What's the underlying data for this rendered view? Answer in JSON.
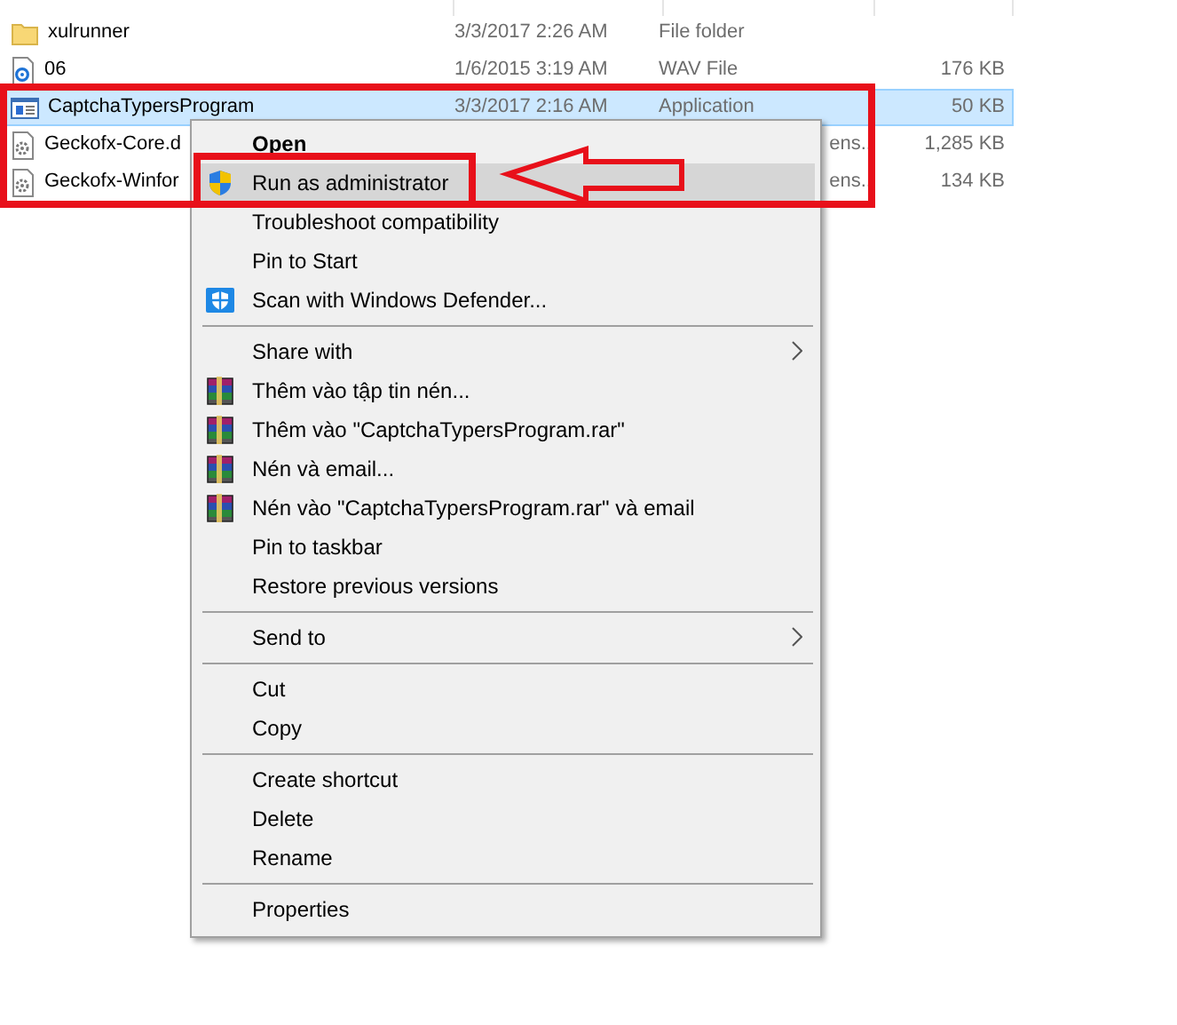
{
  "files": [
    {
      "name": "xulrunner",
      "date": "3/3/2017 2:26 AM",
      "type": "File folder",
      "kind": "folder",
      "selected": false
    },
    {
      "name": "06",
      "date": "1/6/2015 3:19 AM",
      "type": "WAV File",
      "size": "176 KB",
      "kind": "audio",
      "selected": false
    },
    {
      "name": "CaptchaTypersProgram",
      "date": "3/3/2017 2:16 AM",
      "type": "Application",
      "size": "50 KB",
      "kind": "app",
      "selected": true
    },
    {
      "name": "Geckofx-Core.d",
      "type": "ens..",
      "size": "1,285 KB",
      "kind": "dll",
      "covered": true,
      "selected": false
    },
    {
      "name": "Geckofx-Winfor",
      "type": "ens..",
      "size": "134 KB",
      "kind": "dll",
      "covered": true,
      "selected": false
    }
  ],
  "context_menu": [
    {
      "kind": "item",
      "label": "Open",
      "bold": true,
      "selected": false
    },
    {
      "kind": "shield_item",
      "label": "Run as administrator",
      "selected": true
    },
    {
      "kind": "item",
      "label": "Troubleshoot compatibility",
      "selected": false
    },
    {
      "kind": "item",
      "label": "Pin to Start",
      "selected": false
    },
    {
      "kind": "defender_item",
      "label": "Scan with Windows Defender...",
      "selected": false
    },
    {
      "kind": "separator"
    },
    {
      "kind": "item",
      "label": "Share with",
      "submenu": true,
      "selected": false
    },
    {
      "kind": "archive_item",
      "label": "Thêm vào tập tin nén...",
      "selected": false
    },
    {
      "kind": "archive_item",
      "label": "Thêm vào \"CaptchaTypersProgram.rar\"",
      "selected": false
    },
    {
      "kind": "archive_item",
      "label": "Nén và email...",
      "selected": false
    },
    {
      "kind": "archive_item",
      "label": "Nén vào \"CaptchaTypersProgram.rar\" và email",
      "selected": false
    },
    {
      "kind": "item",
      "label": "Pin to taskbar",
      "selected": false
    },
    {
      "kind": "item",
      "label": "Restore previous versions",
      "selected": false
    },
    {
      "kind": "separator"
    },
    {
      "kind": "item",
      "label": "Send to",
      "submenu": true,
      "selected": false
    },
    {
      "kind": "separator"
    },
    {
      "kind": "item",
      "label": "Cut",
      "selected": false
    },
    {
      "kind": "item",
      "label": "Copy",
      "selected": false
    },
    {
      "kind": "separator"
    },
    {
      "kind": "item",
      "label": "Create shortcut",
      "selected": false
    },
    {
      "kind": "item",
      "label": "Delete",
      "selected": false
    },
    {
      "kind": "item",
      "label": "Rename",
      "selected": false
    },
    {
      "kind": "separator"
    },
    {
      "kind": "item",
      "label": "Properties",
      "selected": false
    }
  ]
}
